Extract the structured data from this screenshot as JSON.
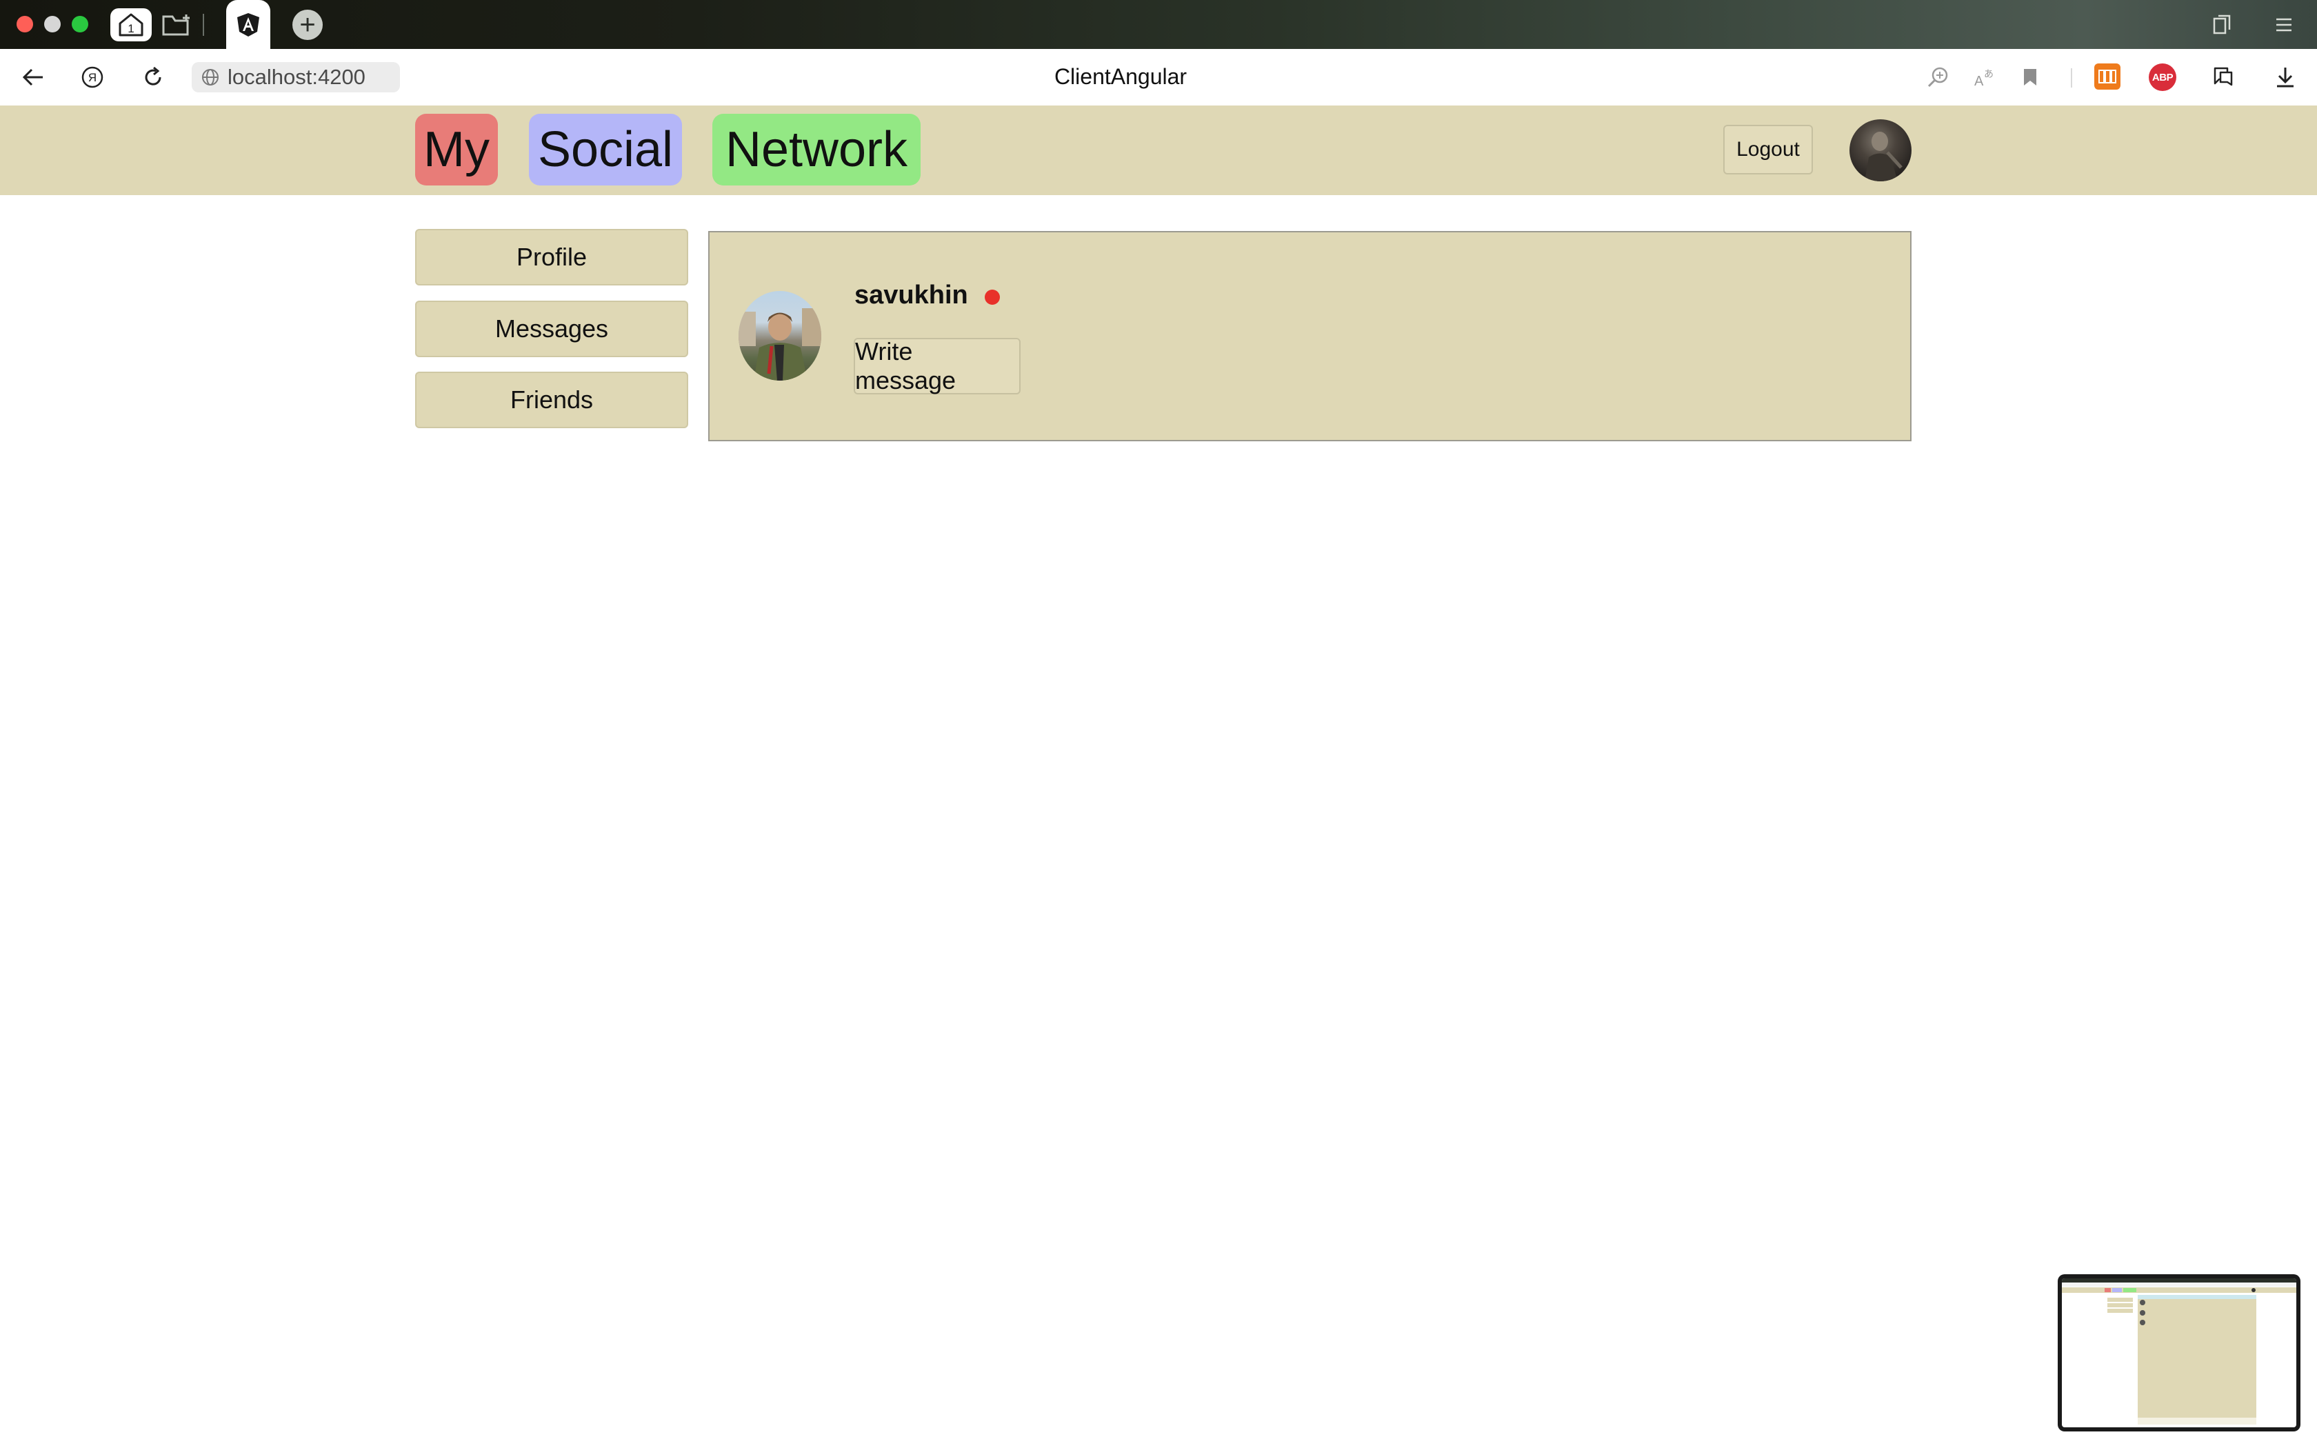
{
  "browser": {
    "tab_count_badge": "1",
    "new_tab_symbol": "+",
    "url": "localhost:4200",
    "page_title": "ClientAngular",
    "abp_label": "ABP",
    "icons": [
      "home-icon",
      "new-folder-icon",
      "angular-icon",
      "new-tab-icon",
      "bookmarks-panel-icon",
      "hamburger-menu-icon",
      "back-icon",
      "yandex-icon",
      "reload-icon",
      "globe-icon",
      "zoom-icon",
      "translate-icon",
      "bookmark-icon",
      "extension-orange-icon",
      "adblock-icon",
      "screenshot-icon",
      "download-icon"
    ]
  },
  "header": {
    "logo": {
      "my": "My",
      "social": "Social",
      "network": "Network"
    },
    "logout_label": "Logout"
  },
  "sidebar": {
    "items": [
      {
        "label": "Profile"
      },
      {
        "label": "Messages"
      },
      {
        "label": "Friends"
      }
    ]
  },
  "profile_card": {
    "username": "savukhin",
    "status": "offline",
    "status_color": "#e8312a",
    "write_message_label": "Write message"
  },
  "colors": {
    "header_bg": "#dfd8b5",
    "logo_my": "#e87c78",
    "logo_social": "#b4b6f8",
    "logo_network": "#93e884"
  }
}
